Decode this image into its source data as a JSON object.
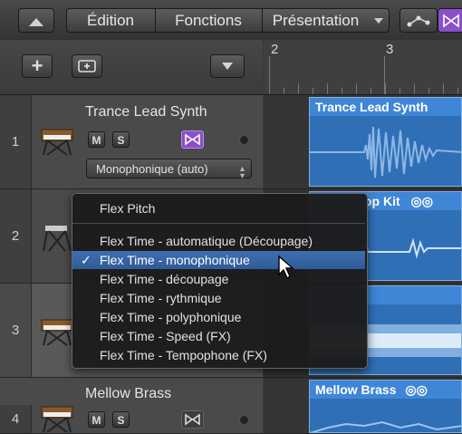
{
  "toolbar": {
    "menus": [
      "Édition",
      "Fonctions",
      "Présentation"
    ]
  },
  "ruler": {
    "bars": [
      "2",
      "3"
    ]
  },
  "tracks": [
    {
      "number": "1",
      "name": "Trance Lead Synth",
      "mute": "M",
      "solo": "S",
      "flex_mode": "Monophonique (auto)"
    },
    {
      "number": "2",
      "name": "",
      "mute": "",
      "solo": ""
    },
    {
      "number": "3",
      "name": ""
    },
    {
      "number": "4",
      "name": "Mellow Brass",
      "mute": "M",
      "solo": "S"
    }
  ],
  "regions": [
    {
      "title": "Trance Lead Synth"
    },
    {
      "title": "op Kit"
    },
    {
      "title": ""
    },
    {
      "title": "Mellow Brass"
    }
  ],
  "menu": {
    "items": [
      "Flex Pitch",
      "Flex Time - automatique (Découpage)",
      "Flex Time - monophonique",
      "Flex Time - découpage",
      "Flex Time - rythmique",
      "Flex Time - polyphonique",
      "Flex Time - Speed (FX)",
      "Flex Time - Tempophone (FX)"
    ],
    "selected_index": 2,
    "checkmark": "✓"
  },
  "colors": {
    "region_blue": "#3f86d6",
    "flex_purple": "#8a4fc9",
    "menu_highlight": "#3f6fb0"
  }
}
